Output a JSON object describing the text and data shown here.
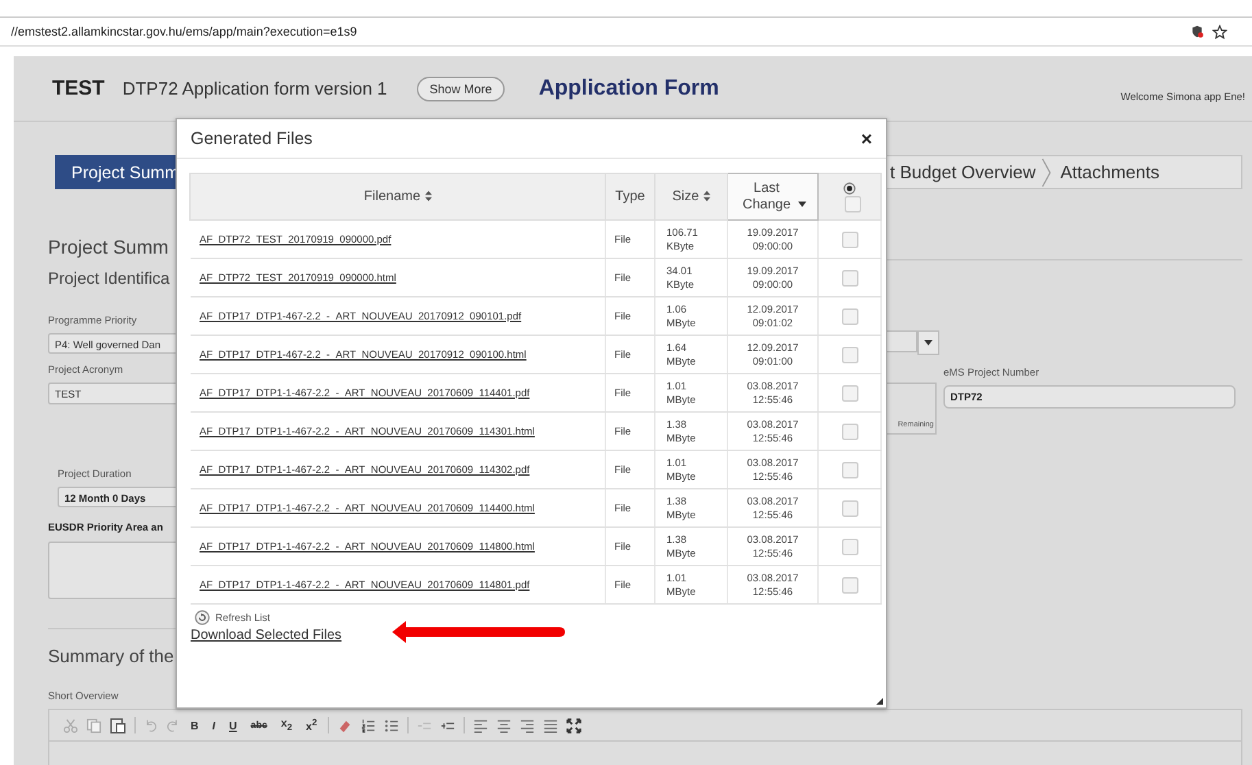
{
  "address_bar": {
    "url": "//emstest2.allamkincstar.gov.hu/ems/app/main?execution=e1s9"
  },
  "header": {
    "brand": "TEST",
    "form_name": "DTP72 Application form version 1",
    "show_more": "Show More",
    "title": "Application Form",
    "welcome": "Welcome Simona app Ene!"
  },
  "tabs": [
    {
      "label": "Project Summ",
      "selected": true
    },
    {
      "label": "t Budget Overview",
      "selected": false
    },
    {
      "label": "Attachments",
      "selected": false
    }
  ],
  "form": {
    "section_title": "Project Summ",
    "subsection_title": "Project Identifica",
    "fields": [
      {
        "label": "Programme Priority",
        "value": "P4: Well governed Dan"
      },
      {
        "label": "Project Acronym",
        "value": "TEST"
      },
      {
        "label": "Project Duration",
        "value": "12 Month 0 Days"
      }
    ],
    "eusdr_label": "EUSDR Priority Area an",
    "remaining": "Remaining",
    "project_number": {
      "label": "eMS Project Number",
      "value": "DTP72"
    },
    "summary_title": "Summary of the",
    "short_overview_label": "Short Overview",
    "editor_toolbar": [
      "B",
      "I",
      "U",
      "abc",
      "x$_{2}$",
      "x$^{2}$"
    ]
  },
  "dialog": {
    "title": "Generated Files",
    "close": "×",
    "columns": [
      {
        "label": "Filename",
        "kind": "sortable"
      },
      {
        "label": "Type",
        "kind": "plain"
      },
      {
        "label": "Size",
        "kind": "sortable"
      },
      {
        "label": "Last Change",
        "kind": "sorted"
      }
    ],
    "select_all": {
      "checked": false
    },
    "rows": [
      {
        "filename": "AF_DTP72_TEST_20170919_090000.pdf",
        "type": "File",
        "size": "106.71 KByte",
        "last_change": "19.09.2017 09:00:00",
        "checked": false
      },
      {
        "filename": "AF_DTP72_TEST_20170919_090000.html",
        "type": "File",
        "size": "34.01 KByte",
        "last_change": "19.09.2017 09:00:00",
        "checked": false
      },
      {
        "filename": "AF_DTP17_DTP1-467-2.2_-_ART_NOUVEAU_20170912_090101.pdf",
        "type": "File",
        "size": "1.06 MByte",
        "last_change": "12.09.2017 09:01:02",
        "checked": false
      },
      {
        "filename": "AF_DTP17_DTP1-467-2.2_-_ART_NOUVEAU_20170912_090100.html",
        "type": "File",
        "size": "1.64 MByte",
        "last_change": "12.09.2017 09:01:00",
        "checked": false
      },
      {
        "filename": "AF_DTP17_DTP1-1-467-2.2_-_ART_NOUVEAU_20170609_114401.pdf",
        "type": "File",
        "size": "1.01 MByte",
        "last_change": "03.08.2017 12:55:46",
        "checked": false
      },
      {
        "filename": "AF_DTP17_DTP1-1-467-2.2_-_ART_NOUVEAU_20170609_114301.html",
        "type": "File",
        "size": "1.38 MByte",
        "last_change": "03.08.2017 12:55:46",
        "checked": false
      },
      {
        "filename": "AF_DTP17_DTP1-1-467-2.2_-_ART_NOUVEAU_20170609_114302.pdf",
        "type": "File",
        "size": "1.01 MByte",
        "last_change": "03.08.2017 12:55:46",
        "checked": false
      },
      {
        "filename": "AF_DTP17_DTP1-1-467-2.2_-_ART_NOUVEAU_20170609_114400.html",
        "type": "File",
        "size": "1.38 MByte",
        "last_change": "03.08.2017 12:55:46",
        "checked": false
      },
      {
        "filename": "AF_DTP17_DTP1-1-467-2.2_-_ART_NOUVEAU_20170609_114800.html",
        "type": "File",
        "size": "1.38 MByte",
        "last_change": "03.08.2017 12:55:46",
        "checked": false
      },
      {
        "filename": "AF_DTP17_DTP1-1-467-2.2_-_ART_NOUVEAU_20170609_114801.pdf",
        "type": "File",
        "size": "1.01 MByte",
        "last_change": "03.08.2017 12:55:46",
        "checked": false
      }
    ],
    "refresh": "Refresh List",
    "download": "Download Selected Files"
  }
}
